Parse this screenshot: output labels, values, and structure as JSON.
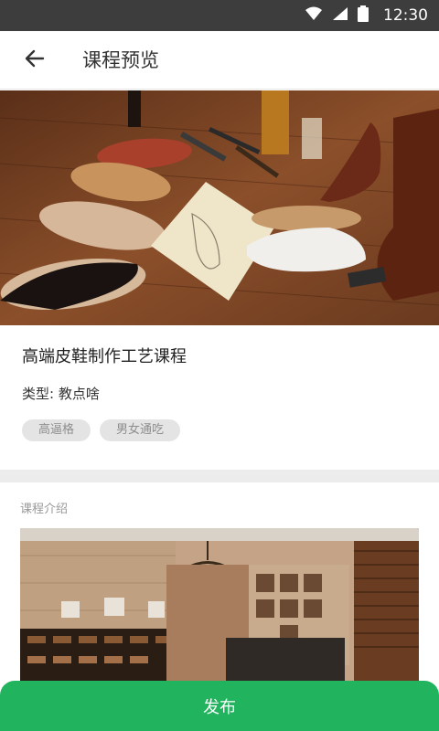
{
  "status_bar": {
    "time": "12:30",
    "icons": [
      "wifi-icon",
      "signal-icon",
      "battery-icon"
    ]
  },
  "app_bar": {
    "title": "课程预览",
    "back_icon": "arrow-left-icon"
  },
  "course": {
    "title": "高端皮鞋制作工艺课程",
    "type_label": "类型: 教点啥",
    "tags": [
      "高逼格",
      "男女通吃"
    ]
  },
  "intro": {
    "section_label": "课程介绍"
  },
  "footer": {
    "publish_label": "发布"
  },
  "colors": {
    "accent": "#22b35e",
    "status_bar": "#3d3d3d",
    "tag_bg": "#e4e4e4"
  }
}
